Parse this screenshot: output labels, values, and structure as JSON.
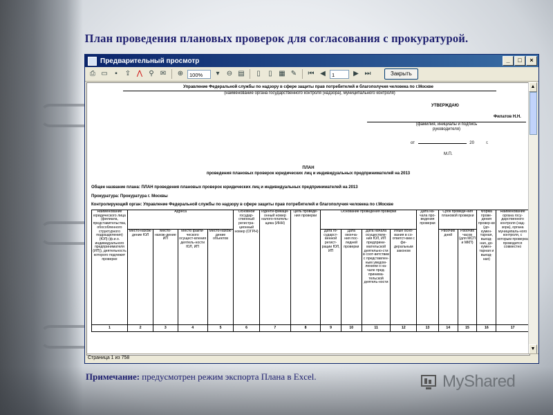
{
  "slide": {
    "title": "План проведения плановых проверок для согласования с прокуратурой.",
    "note_prefix": "Примечание:",
    "note_text": " предусмотрен режим экспорта Плана в Excel.",
    "logo_text": "MyShared"
  },
  "window": {
    "title": "Предварительный просмотр",
    "zoom_value": "100%",
    "page_value": "1",
    "close_button_label": "Закрыть",
    "status_text": "Страница 1 из 758"
  },
  "doc": {
    "agency": "Управление Федеральной службы по надзору в сфере защиты прав потребителей и благополучия человека по г.Москве",
    "agency_caption": "(наименование органа государственного контроля (надзора), муниципального контроля)",
    "approve": "УТВЕРЖДАЮ",
    "signer": "Филатов Н.Н.",
    "signer_caption_1": "(фамилия, инициалы и подпись",
    "signer_caption_2": "руководителя)",
    "date_from": "от",
    "date_year": "20",
    "date_suffix": "г.",
    "stamp": "М.П.",
    "plan_heading": "ПЛАН",
    "plan_subheading": "проведения плановых проверок юридических лиц и индивидуальных предпринимателей на 2013",
    "general_name": "Общее название плана: ПЛАН проведения плановых проверок юридических лиц и индивидуальных предпринимателей на 2013",
    "prosecutor": "Прокуратура: Прокуратура г. Москвы",
    "controlling_body": "Контролирующий орган: Управление Федеральной службы по надзору в сфере защиты прав потребителей и благополучия человека по г.Москве"
  },
  "table": {
    "h_name": "Наименование юридического лица (филиала, представительства, обособленного структурного подразделения) (ЮЛ) (ф.и.о. индивидуального предпринимателя (ИП)), деятельность которого подлежит проверке",
    "h_address": "Адреса",
    "h_addr_ul": "Место-нахож-дение ЮЛ",
    "h_addr_ip": "Место-нахож-дение ИП",
    "h_addr_fact": "Место факти-ческого осущест-вления деятель-ности ЮЛ, ИП",
    "h_addr_obj": "Место-нахож-дение объектов",
    "h_ogrn": "Основной государ-ственный регистра-ционный номер (ОГРН)",
    "h_inn": "Иденти-фикаци-онный номер налого-платель-щика (ИНН)",
    "h_purpose": "Цель проведе-ния проверки",
    "h_basis": "Основание проведения проверки",
    "h_basis_reg": "Дата го-сударст-венной регист-рации ЮЛ, ИП",
    "h_basis_last": "Дата оконча-ния пос-ледней проверки",
    "h_basis_start": "Дата начала осуществле-ния ЮЛ, ИП предприни-мательской деятельно-сти в соот-ветствии с представлен-ным уведом-лением о на-чале пред-принима-тельской деятель-ности",
    "h_basis_other": "Иные осно-вания в со-ответст-вии с фе-деральным законом",
    "h_start_date": "Дата на-чала про-ведения проверки",
    "h_term": "Срок проведе-ния плановой проверки",
    "h_term_days": "Рабочих дней",
    "h_term_hours": "Рабочих часов (для МСП и МКП)",
    "h_form": "Форма прове-дения провер-ки (до-кумен-тарная, выезд-ная, до-кумен-тарная и выезд-ная)",
    "h_authority": "Наименование органа госу-дарственного контроля (над-зора), органа муниципаль-ного контроля, с которым проверка проводится совместно",
    "col_numbers": [
      "1",
      "2",
      "3",
      "4",
      "5",
      "6",
      "7",
      "8",
      "9",
      "10",
      "11",
      "12",
      "13",
      "14",
      "15",
      "16",
      "17"
    ]
  }
}
